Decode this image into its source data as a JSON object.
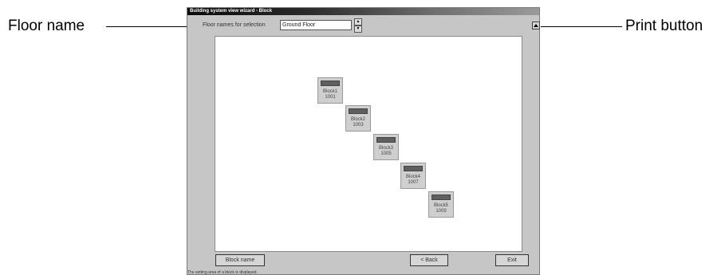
{
  "callouts": {
    "floor_name": "Floor name",
    "print_button": "Print button"
  },
  "window": {
    "title": "Building system view wizard - Block",
    "floor_label": "Floor names for selection",
    "floor_value": "Ground Floor",
    "spinner": {
      "up": "▲",
      "down": "▼"
    },
    "print_icon": "print-icon",
    "blocks": [
      {
        "name": "Block1",
        "code": "1001"
      },
      {
        "name": "Block2",
        "code": "1003"
      },
      {
        "name": "Block3",
        "code": "1005"
      },
      {
        "name": "Block4",
        "code": "1007"
      },
      {
        "name": "Block5",
        "code": "1009"
      }
    ],
    "buttons": {
      "block_name": "Block name",
      "back": "< Back",
      "exit": "Exit"
    },
    "status": "The setting area of a block is displayed."
  },
  "colors": {
    "window_bg": "#c6c6c6",
    "canvas_bg": "#ffffff",
    "block_header": "#5f5f5f"
  }
}
